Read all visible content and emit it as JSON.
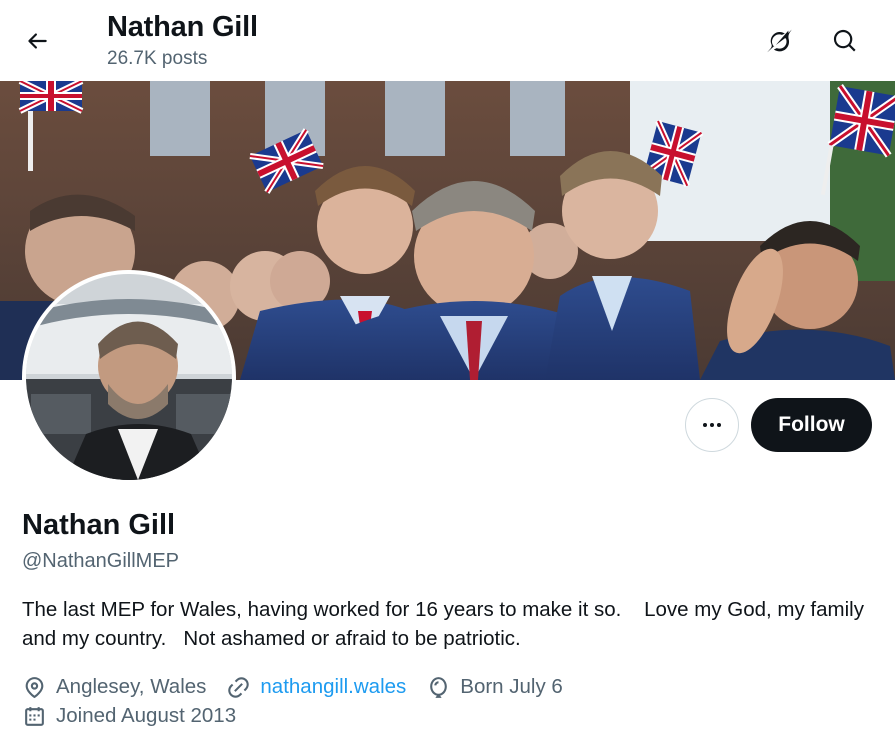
{
  "header": {
    "name": "Nathan Gill",
    "posts": "26.7K posts",
    "icons": [
      "back-arrow-icon",
      "grok-icon",
      "search-icon"
    ]
  },
  "banner": {
    "description_icon": "crowd-with-union-jack-flags-image"
  },
  "profile": {
    "display_name": "Nathan Gill",
    "handle": "@NathanGillMEP",
    "bio": "The last MEP for Wales, having worked for 16 years to make it so.    Love my God, my family and my country.   Not ashamed or afraid to be patriotic.",
    "location": "Anglesey, Wales",
    "website": "nathangill.wales",
    "birthday": "Born July 6",
    "joined": "Joined August 2013"
  },
  "actions": {
    "more_label": "•••",
    "follow_label": "Follow"
  },
  "colors": {
    "text_primary": "#0f1419",
    "text_secondary": "#536471",
    "link": "#1d9bf0",
    "follow_bg": "#0f1419",
    "border": "#cfd9de"
  }
}
